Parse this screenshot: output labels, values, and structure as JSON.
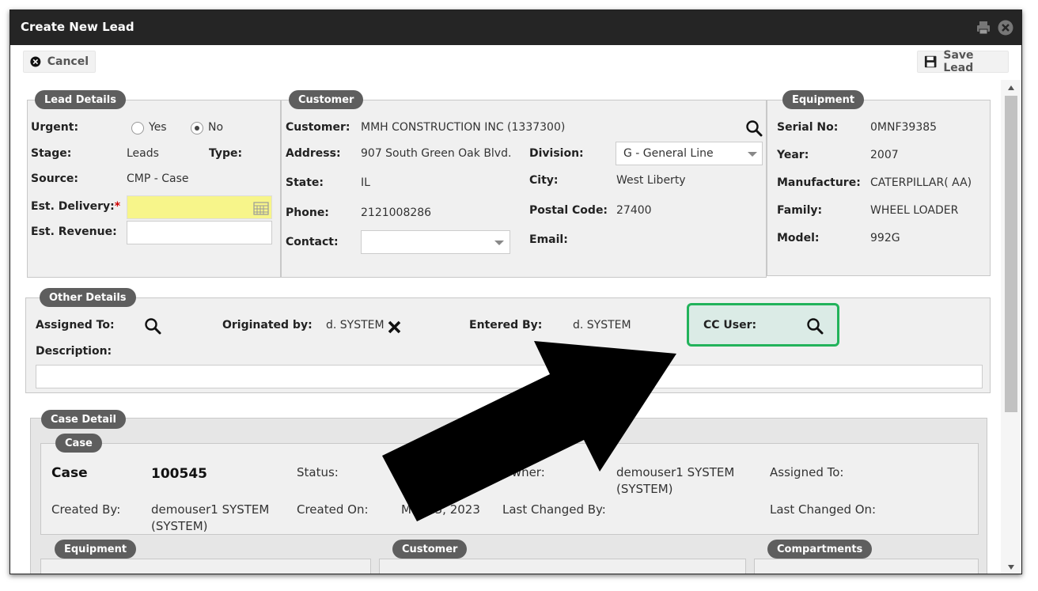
{
  "window": {
    "title": "Create New Lead"
  },
  "toolbar": {
    "cancel_label": "Cancel",
    "save_label": "Save Lead"
  },
  "lead_details": {
    "legend": "Lead Details",
    "urgent_label": "Urgent:",
    "urgent_options": [
      "Yes",
      "No"
    ],
    "urgent_selected": "No",
    "stage_label": "Stage:",
    "stage_value": "Leads",
    "type_label": "Type:",
    "source_label": "Source:",
    "source_value": "CMP - Case",
    "est_delivery_label": "Est. Delivery:",
    "required_mark": "*",
    "est_revenue_label": "Est. Revenue:"
  },
  "customer": {
    "legend": "Customer",
    "customer_label": "Customer:",
    "customer_value": "MMH CONSTRUCTION INC (1337300)",
    "address_label": "Address:",
    "address_value": "907 South Green Oak Blvd.",
    "division_label": "Division:",
    "division_value": "G - General Line",
    "state_label": "State:",
    "state_value": "IL",
    "city_label": "City:",
    "city_value": "West Liberty",
    "phone_label": "Phone:",
    "phone_value": "2121008286",
    "postal_label": "Postal Code:",
    "postal_value": "27400",
    "contact_label": "Contact:",
    "email_label": "Email:"
  },
  "equipment": {
    "legend": "Equipment",
    "serial_label": "Serial No:",
    "serial_value": "0MNF39385",
    "year_label": "Year:",
    "year_value": "2007",
    "manufacture_label": "Manufacture:",
    "manufacture_value": "CATERPILLAR( AA)",
    "family_label": "Family:",
    "family_value": "WHEEL LOADER",
    "model_label": "Model:",
    "model_value": "992G"
  },
  "other_details": {
    "legend": "Other Details",
    "assigned_to_label": "Assigned To:",
    "originated_by_label": "Originated by:",
    "originated_by_value": "d. SYSTEM",
    "entered_by_label": "Entered By:",
    "entered_by_value": "d. SYSTEM",
    "cc_user_label": "CC User:",
    "description_label": "Description:"
  },
  "case_detail": {
    "legend": "Case Detail",
    "case_legend": "Case",
    "case_label": "Case",
    "case_value": "100545",
    "status_label": "Status:",
    "owner_label": "Owner:",
    "owner_value_line1": "demouser1 SYSTEM",
    "owner_value_line2": "(SYSTEM)",
    "assigned_to_label": "Assigned To:",
    "created_by_label": "Created By:",
    "created_by_line1": "demouser1 SYSTEM",
    "created_by_line2": "(SYSTEM)",
    "created_on_label": "Created On:",
    "created_on_value": "Mar 23, 2023",
    "last_changed_by_label": "Last Changed By:",
    "last_changed_on_label": "Last Changed On:",
    "sub_legends": [
      "Equipment",
      "Customer",
      "Compartments"
    ]
  },
  "colors": {
    "highlight_border": "#22b35b",
    "highlight_fill": "#dbebe6",
    "titlebar": "#252525",
    "legend": "#5e5e5e",
    "required": "#d00000"
  },
  "icons": [
    "cancel-icon",
    "save-icon",
    "print-icon",
    "close-icon",
    "search-icon",
    "calendar-icon",
    "remove-icon",
    "callout-arrow"
  ]
}
